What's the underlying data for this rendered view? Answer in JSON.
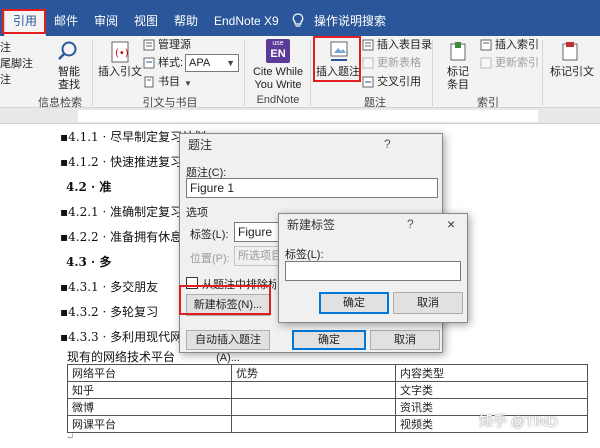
{
  "tabs": [
    "引用",
    "邮件",
    "审阅",
    "视图",
    "帮助",
    "EndNote X9",
    "操作说明搜索"
  ],
  "ribbon": {
    "left_cut": [
      "注",
      "尾脚注",
      "注"
    ],
    "footnote_group_label": "信息检索",
    "smart_lookup": [
      "智能",
      "查找"
    ],
    "insert_citation": "插入引文",
    "manage_sources": "管理源",
    "style_label": "样式:",
    "style_value": "APA",
    "bibliography": "书目",
    "citations_group_label": "引文与书目",
    "cite_while": [
      "Cite While",
      "You Write"
    ],
    "endnote_group_label": "EndNote",
    "insert_caption": "插入题注",
    "insert_toc": "插入表目录",
    "update_table": "更新表格",
    "cross_ref": "交叉引用",
    "captions_group_label": "题注",
    "mark_entry": [
      "标记",
      "条目"
    ],
    "insert_index": "插入索引",
    "update_index": "更新索引",
    "index_group_label": "索引",
    "mark_citation": "标记引文",
    "use_icon_text": "use",
    "en_icon_text": "EN"
  },
  "document": {
    "lines": [
      {
        "text": "4.1.1 · 尽早制定复习计划",
        "bold": false
      },
      {
        "text": "4.1.2 · 快速推进复习进",
        "bold": false
      },
      {
        "text": "4.2 · 准",
        "bold": true
      },
      {
        "text": "4.2.1 · 准确制定复习",
        "bold": false
      },
      {
        "text": "4.2.2 · 准备拥有休息时",
        "bold": false
      },
      {
        "text": "4.3 · 多",
        "bold": true
      },
      {
        "text": "4.3.1 · 多交朋友",
        "bold": false
      },
      {
        "text": "4.3.2 · 多轮复习",
        "bold": false
      },
      {
        "text": "4.3.3 · 多利用现代网络",
        "bold": false
      }
    ],
    "table_caption": "现有的网络技术平台",
    "table": [
      [
        "网络平台",
        "优势",
        "内容类型"
      ],
      [
        "知乎",
        "",
        "文字类"
      ],
      [
        "微博",
        "",
        "资讯类"
      ],
      [
        "网课平台",
        "",
        "视频类"
      ]
    ]
  },
  "caption_dialog": {
    "title": "题注",
    "help": "?",
    "caption_label": "题注(C):",
    "caption_value": "Figure 1",
    "options_label": "选项",
    "label_label": "标签(L):",
    "label_value": "Figure",
    "position_label": "位置(P):",
    "position_value": "所选项目下",
    "exclude_label": "从题注中排除标签(E)",
    "new_label_button": "新建标签(N)...",
    "auto_caption_button": "自动插入题注(A)...",
    "ok_button": "确定",
    "cancel_button": "取消"
  },
  "new_label_dialog": {
    "title": "新建标签",
    "help": "?",
    "close": "×",
    "label_label": "标签(L):",
    "label_value": "",
    "ok_button": "确定",
    "cancel_button": "取消"
  },
  "watermark": "知乎 @TIND",
  "colors": {
    "ribbon_blue": "#2b579a",
    "highlight_red": "#e02020",
    "default_button_blue": "#0078d7"
  }
}
